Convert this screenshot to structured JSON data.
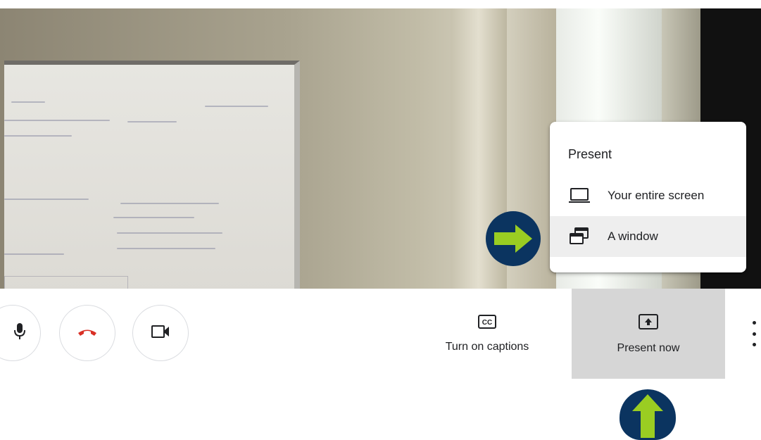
{
  "present_menu": {
    "title": "Present",
    "items": [
      {
        "label": "Your entire screen",
        "icon": "laptop-icon"
      },
      {
        "label": "A window",
        "icon": "window-icon"
      }
    ]
  },
  "controls": {
    "mic_icon": "microphone-icon",
    "hangup_icon": "hang-up-icon",
    "camera_icon": "camera-icon",
    "captions_label": "Turn on captions",
    "present_label": "Present now",
    "more_icon": "more-vert-icon"
  },
  "colors": {
    "callout_bg": "#0b3460",
    "callout_arrow": "#9acd22",
    "hangup_red": "#d93025",
    "present_btn_bg": "#d6d6d6"
  }
}
